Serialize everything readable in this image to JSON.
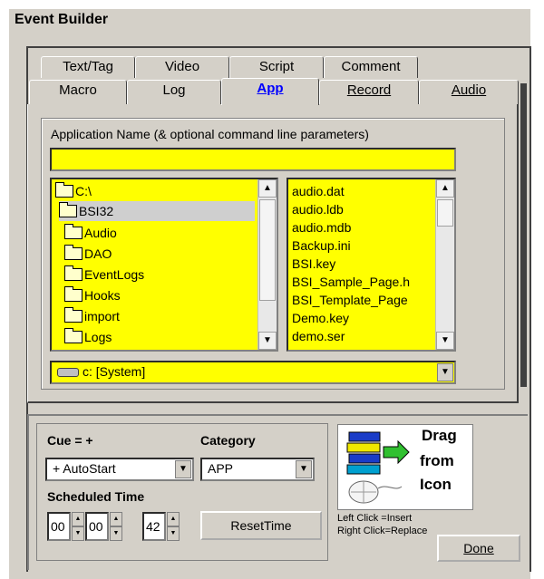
{
  "window": {
    "title": "Event Builder"
  },
  "tabs_row1": [
    "Text/Tag",
    "Video",
    "Script",
    "Comment"
  ],
  "tabs_row2": [
    "Macro",
    "Log",
    "App",
    "Record",
    "Audio"
  ],
  "active_tab": "App",
  "app_panel": {
    "app_name_label": "Application Name (& optional command line parameters)",
    "app_name_value": "",
    "folders": [
      "C:\\",
      "BSI32",
      "Audio",
      "DAO",
      "EventLogs",
      "Hooks",
      "import",
      "Logs"
    ],
    "selected_folder": "BSI32",
    "files": [
      "audio.dat",
      "audio.ldb",
      "audio.mdb",
      "Backup.ini",
      "BSI.key",
      "BSI_Sample_Page.h",
      "BSI_Template_Page",
      "Demo.key",
      "demo.ser"
    ],
    "drive": "c: [System]"
  },
  "bottom": {
    "cue_label": "Cue = +",
    "cue_value": "+ AutoStart",
    "category_label": "Category",
    "category_value": "APP",
    "scheduled_label": "Scheduled Time",
    "time_h": "00",
    "time_m": "00",
    "time_s": "42",
    "reset_label": "ResetTime",
    "drag_line1": "Drag",
    "drag_line2": "from",
    "drag_line3": "Icon",
    "left_click": "Left Click  =Insert",
    "right_click": "Right Click=Replace",
    "done_label": "Done"
  }
}
